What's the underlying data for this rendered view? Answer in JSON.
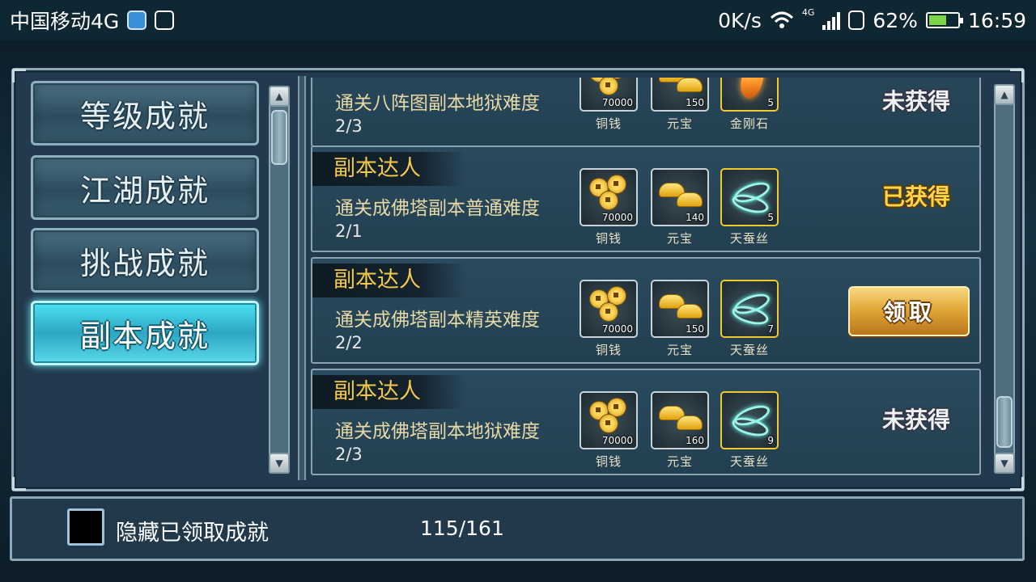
{
  "statusbar": {
    "carrier": "中国移动4G",
    "speed": "0K/s",
    "network_tag": "4G",
    "battery": "62%",
    "battery_level": 0.62,
    "time": "16:59"
  },
  "categories": [
    {
      "label": "等级成就",
      "active": false
    },
    {
      "label": "江湖成就",
      "active": false
    },
    {
      "label": "挑战成就",
      "active": false
    },
    {
      "label": "副本成就",
      "active": true
    }
  ],
  "achievements": [
    {
      "title": "",
      "desc": "通关八阵图副本地狱难度",
      "progress": "2/3",
      "rewards": [
        {
          "name": "铜钱",
          "qty": "70000",
          "icon": "coins-icon"
        },
        {
          "name": "元宝",
          "qty": "150",
          "icon": "ingot-icon"
        },
        {
          "name": "金刚石",
          "qty": "5",
          "icon": "diamond-icon"
        }
      ],
      "status": "未获得",
      "status_type": "not"
    },
    {
      "title": "副本达人",
      "desc": "通关成佛塔副本普通难度",
      "progress": "2/1",
      "rewards": [
        {
          "name": "铜钱",
          "qty": "70000",
          "icon": "coins-icon"
        },
        {
          "name": "元宝",
          "qty": "140",
          "icon": "ingot-icon"
        },
        {
          "name": "天蚕丝",
          "qty": "5",
          "icon": "silk-icon"
        }
      ],
      "status": "已获得",
      "status_type": "got"
    },
    {
      "title": "副本达人",
      "desc": "通关成佛塔副本精英难度",
      "progress": "2/2",
      "rewards": [
        {
          "name": "铜钱",
          "qty": "70000",
          "icon": "coins-icon"
        },
        {
          "name": "元宝",
          "qty": "150",
          "icon": "ingot-icon"
        },
        {
          "name": "天蚕丝",
          "qty": "7",
          "icon": "silk-icon"
        }
      ],
      "status": "领取",
      "status_type": "claim"
    },
    {
      "title": "副本达人",
      "desc": "通关成佛塔副本地狱难度",
      "progress": "2/3",
      "rewards": [
        {
          "name": "铜钱",
          "qty": "70000",
          "icon": "coins-icon"
        },
        {
          "name": "元宝",
          "qty": "160",
          "icon": "ingot-icon"
        },
        {
          "name": "天蚕丝",
          "qty": "9",
          "icon": "silk-icon"
        }
      ],
      "status": "未获得",
      "status_type": "not"
    }
  ],
  "bottom": {
    "hide_label": "隐藏已领取成就",
    "hide_checked": false,
    "count": "115/161"
  },
  "colors": {
    "accent_gold": "#f4c94a",
    "active_cyan": "#4ce1f2"
  }
}
